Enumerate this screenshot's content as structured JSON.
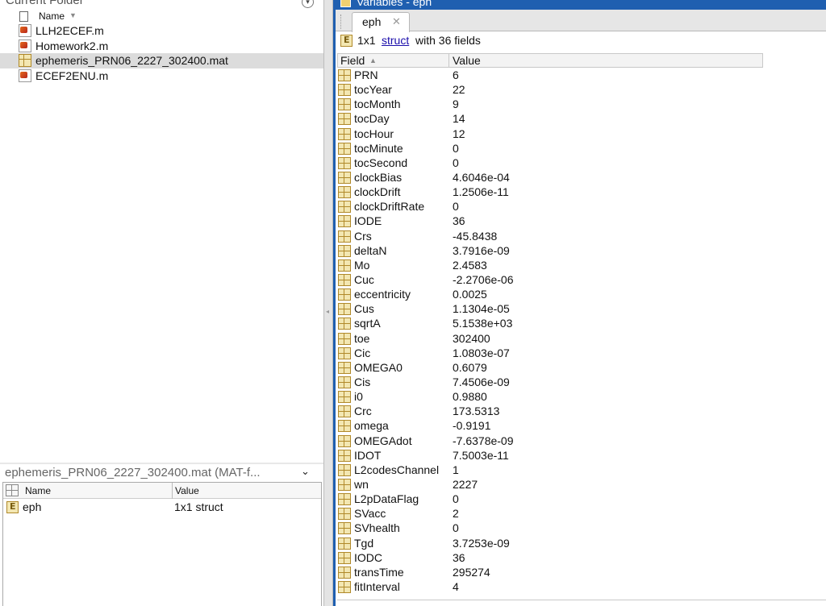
{
  "current_folder": {
    "title": "Current Folder",
    "column_name": "Name",
    "files": [
      {
        "name": "LLH2ECEF.m",
        "icon": "m-file-icon",
        "selected": false
      },
      {
        "name": "Homework2.m",
        "icon": "m-file-icon",
        "selected": false
      },
      {
        "name": "ephemeris_PRN06_2227_302400.mat",
        "icon": "mat-file-icon",
        "selected": true
      },
      {
        "name": "ECEF2ENU.m",
        "icon": "m-file-icon",
        "selected": false
      }
    ]
  },
  "workspace": {
    "details_title": "ephemeris_PRN06_2227_302400.mat  (MAT-f...",
    "columns": {
      "name": "Name",
      "value": "Value"
    },
    "rows": [
      {
        "name": "eph",
        "value": "1x1 struct"
      }
    ]
  },
  "variables": {
    "window_title": "Variables - eph",
    "tab_label": "eph",
    "summary": {
      "size": "1x1",
      "link": "struct",
      "rest": "with 36 fields"
    },
    "columns": {
      "field": "Field",
      "value": "Value"
    },
    "fields": [
      {
        "field": "PRN",
        "value": "6"
      },
      {
        "field": "tocYear",
        "value": "22"
      },
      {
        "field": "tocMonth",
        "value": "9"
      },
      {
        "field": "tocDay",
        "value": "14"
      },
      {
        "field": "tocHour",
        "value": "12"
      },
      {
        "field": "tocMinute",
        "value": "0"
      },
      {
        "field": "tocSecond",
        "value": "0"
      },
      {
        "field": "clockBias",
        "value": "4.6046e-04"
      },
      {
        "field": "clockDrift",
        "value": "1.2506e-11"
      },
      {
        "field": "clockDriftRate",
        "value": "0"
      },
      {
        "field": "IODE",
        "value": "36"
      },
      {
        "field": "Crs",
        "value": "-45.8438"
      },
      {
        "field": "deltaN",
        "value": "3.7916e-09"
      },
      {
        "field": "Mo",
        "value": "2.4583"
      },
      {
        "field": "Cuc",
        "value": "-2.2706e-06"
      },
      {
        "field": "eccentricity",
        "value": "0.0025"
      },
      {
        "field": "Cus",
        "value": "1.1304e-05"
      },
      {
        "field": "sqrtA",
        "value": "5.1538e+03"
      },
      {
        "field": "toe",
        "value": "302400"
      },
      {
        "field": "Cic",
        "value": "1.0803e-07"
      },
      {
        "field": "OMEGA0",
        "value": "0.6079"
      },
      {
        "field": "Cis",
        "value": "7.4506e-09"
      },
      {
        "field": "i0",
        "value": "0.9880"
      },
      {
        "field": "Crc",
        "value": "173.5313"
      },
      {
        "field": "omega",
        "value": "-0.9191"
      },
      {
        "field": "OMEGAdot",
        "value": "-7.6378e-09"
      },
      {
        "field": "IDOT",
        "value": "7.5003e-11"
      },
      {
        "field": "L2codesChannel",
        "value": "1"
      },
      {
        "field": "wn",
        "value": "2227"
      },
      {
        "field": "L2pDataFlag",
        "value": "0"
      },
      {
        "field": "SVacc",
        "value": "2"
      },
      {
        "field": "SVhealth",
        "value": "0"
      },
      {
        "field": "Tgd",
        "value": "3.7253e-09"
      },
      {
        "field": "IODC",
        "value": "36"
      },
      {
        "field": "transTime",
        "value": "295274"
      },
      {
        "field": "fitInterval",
        "value": "4"
      }
    ]
  },
  "colors": {
    "titlebar": "#1f5fb0",
    "selection": "#dcdcdc",
    "link": "#1a0dab"
  }
}
